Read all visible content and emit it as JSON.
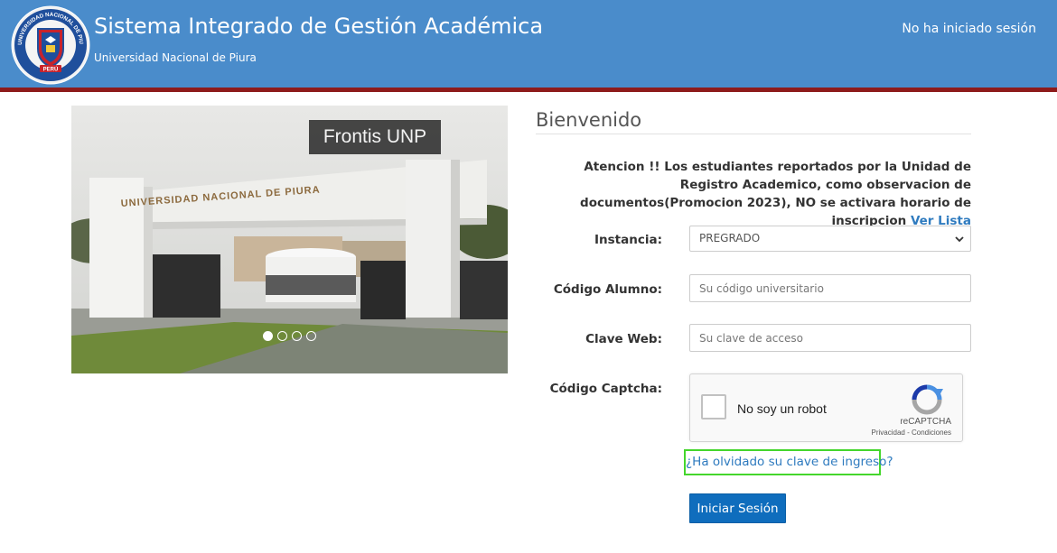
{
  "header": {
    "title": "Sistema Integrado de Gestión Académica",
    "subtitle": "Universidad Nacional de Piura",
    "session_status": "No ha iniciado sesión",
    "background_color": "#4a8ccb",
    "accent_bar_color": "#8e1b1b",
    "logo": {
      "icon": "university-seal-icon",
      "ring_text": "UNIVERSIDAD NACIONAL DE PIURA",
      "bottom_text": "PERÚ"
    }
  },
  "carousel": {
    "caption": "Frontis UNP",
    "sign_text": "UNIVERSIDAD NACIONAL DE PIURA",
    "slide_count": 4,
    "active_slide": 1
  },
  "form": {
    "welcome_heading": "Bienvenido",
    "notice_text": "Atencion !! Los estudiantes reportados por la Unidad de Registro Academico, como observacion de documentos(Promocion 2023), NO se activara horario de inscripcion",
    "notice_link": "Ver Lista",
    "fields": {
      "instancia_label": "Instancia:",
      "instancia_value": "PREGRADO",
      "codigo_label": "Código Alumno:",
      "codigo_placeholder": "Su código universitario",
      "clave_label": "Clave Web:",
      "clave_placeholder": "Su clave de acceso",
      "captcha_label": "Código Captcha:"
    },
    "captcha": {
      "checkbox_label": "No soy un robot",
      "brand": "reCAPTCHA",
      "terms": "Privacidad - Condiciones"
    },
    "forgot_link": "¿Ha olvidado su clave de ingreso?",
    "login_button": "Iniciar Sesión",
    "link_color": "#2f7bbf",
    "button_color": "#0f6dbd",
    "highlight_color": "#44d62c"
  }
}
